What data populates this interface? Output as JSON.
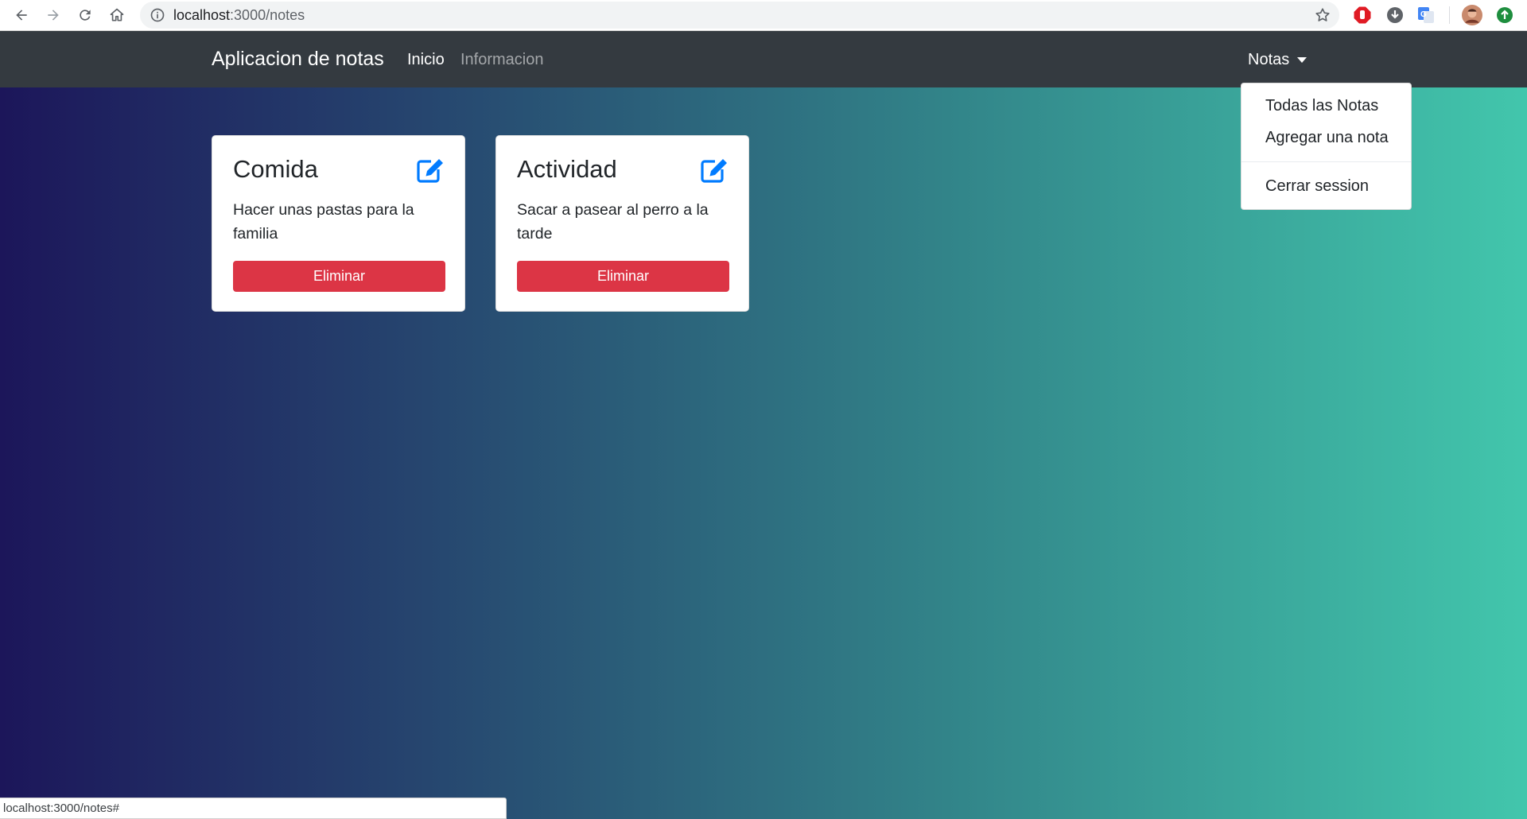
{
  "browser": {
    "url_host": "localhost",
    "url_path": ":3000/notes",
    "status_text": "localhost:3000/notes#"
  },
  "navbar": {
    "brand": "Aplicacion de notas",
    "links": [
      "Inicio",
      "Informacion"
    ],
    "dropdown_label": "Notas",
    "dropdown_items": [
      "Todas las Notas",
      "Agregar una nota",
      "Cerrar session"
    ]
  },
  "notes": [
    {
      "title": "Comida",
      "description": "Hacer unas pastas para la familia",
      "delete_label": "Eliminar"
    },
    {
      "title": "Actividad",
      "description": "Sacar a pasear al perro a la tarde",
      "delete_label": "Eliminar"
    }
  ],
  "colors": {
    "navbar_bg": "#343a40",
    "danger": "#dc3545",
    "primary": "#007bff",
    "gradient_start": "#1c165a",
    "gradient_end": "#42c6ac"
  },
  "icons": {
    "back": "arrow-left-icon",
    "forward": "arrow-right-icon",
    "reload": "reload-icon",
    "home": "home-icon",
    "info": "info-icon",
    "bookmark": "star-icon",
    "edit": "edit-icon",
    "dropdown": "caret-down-icon"
  }
}
